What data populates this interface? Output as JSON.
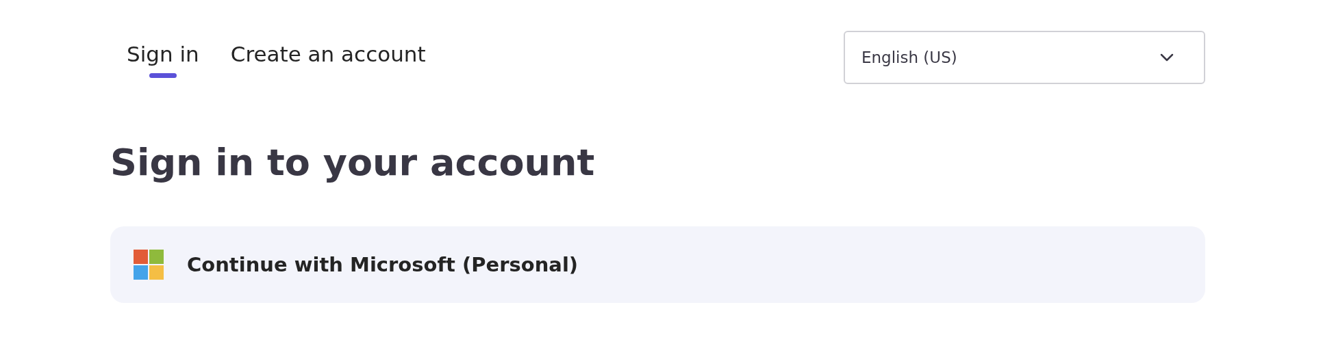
{
  "tabs": [
    {
      "label": "Sign in",
      "selected": true
    },
    {
      "label": "Create an account",
      "selected": false
    }
  ],
  "language_select": {
    "value": "English (US)"
  },
  "heading": "Sign in to your account",
  "sign_in_options": [
    {
      "label": "Continue with Microsoft (Personal)"
    }
  ]
}
